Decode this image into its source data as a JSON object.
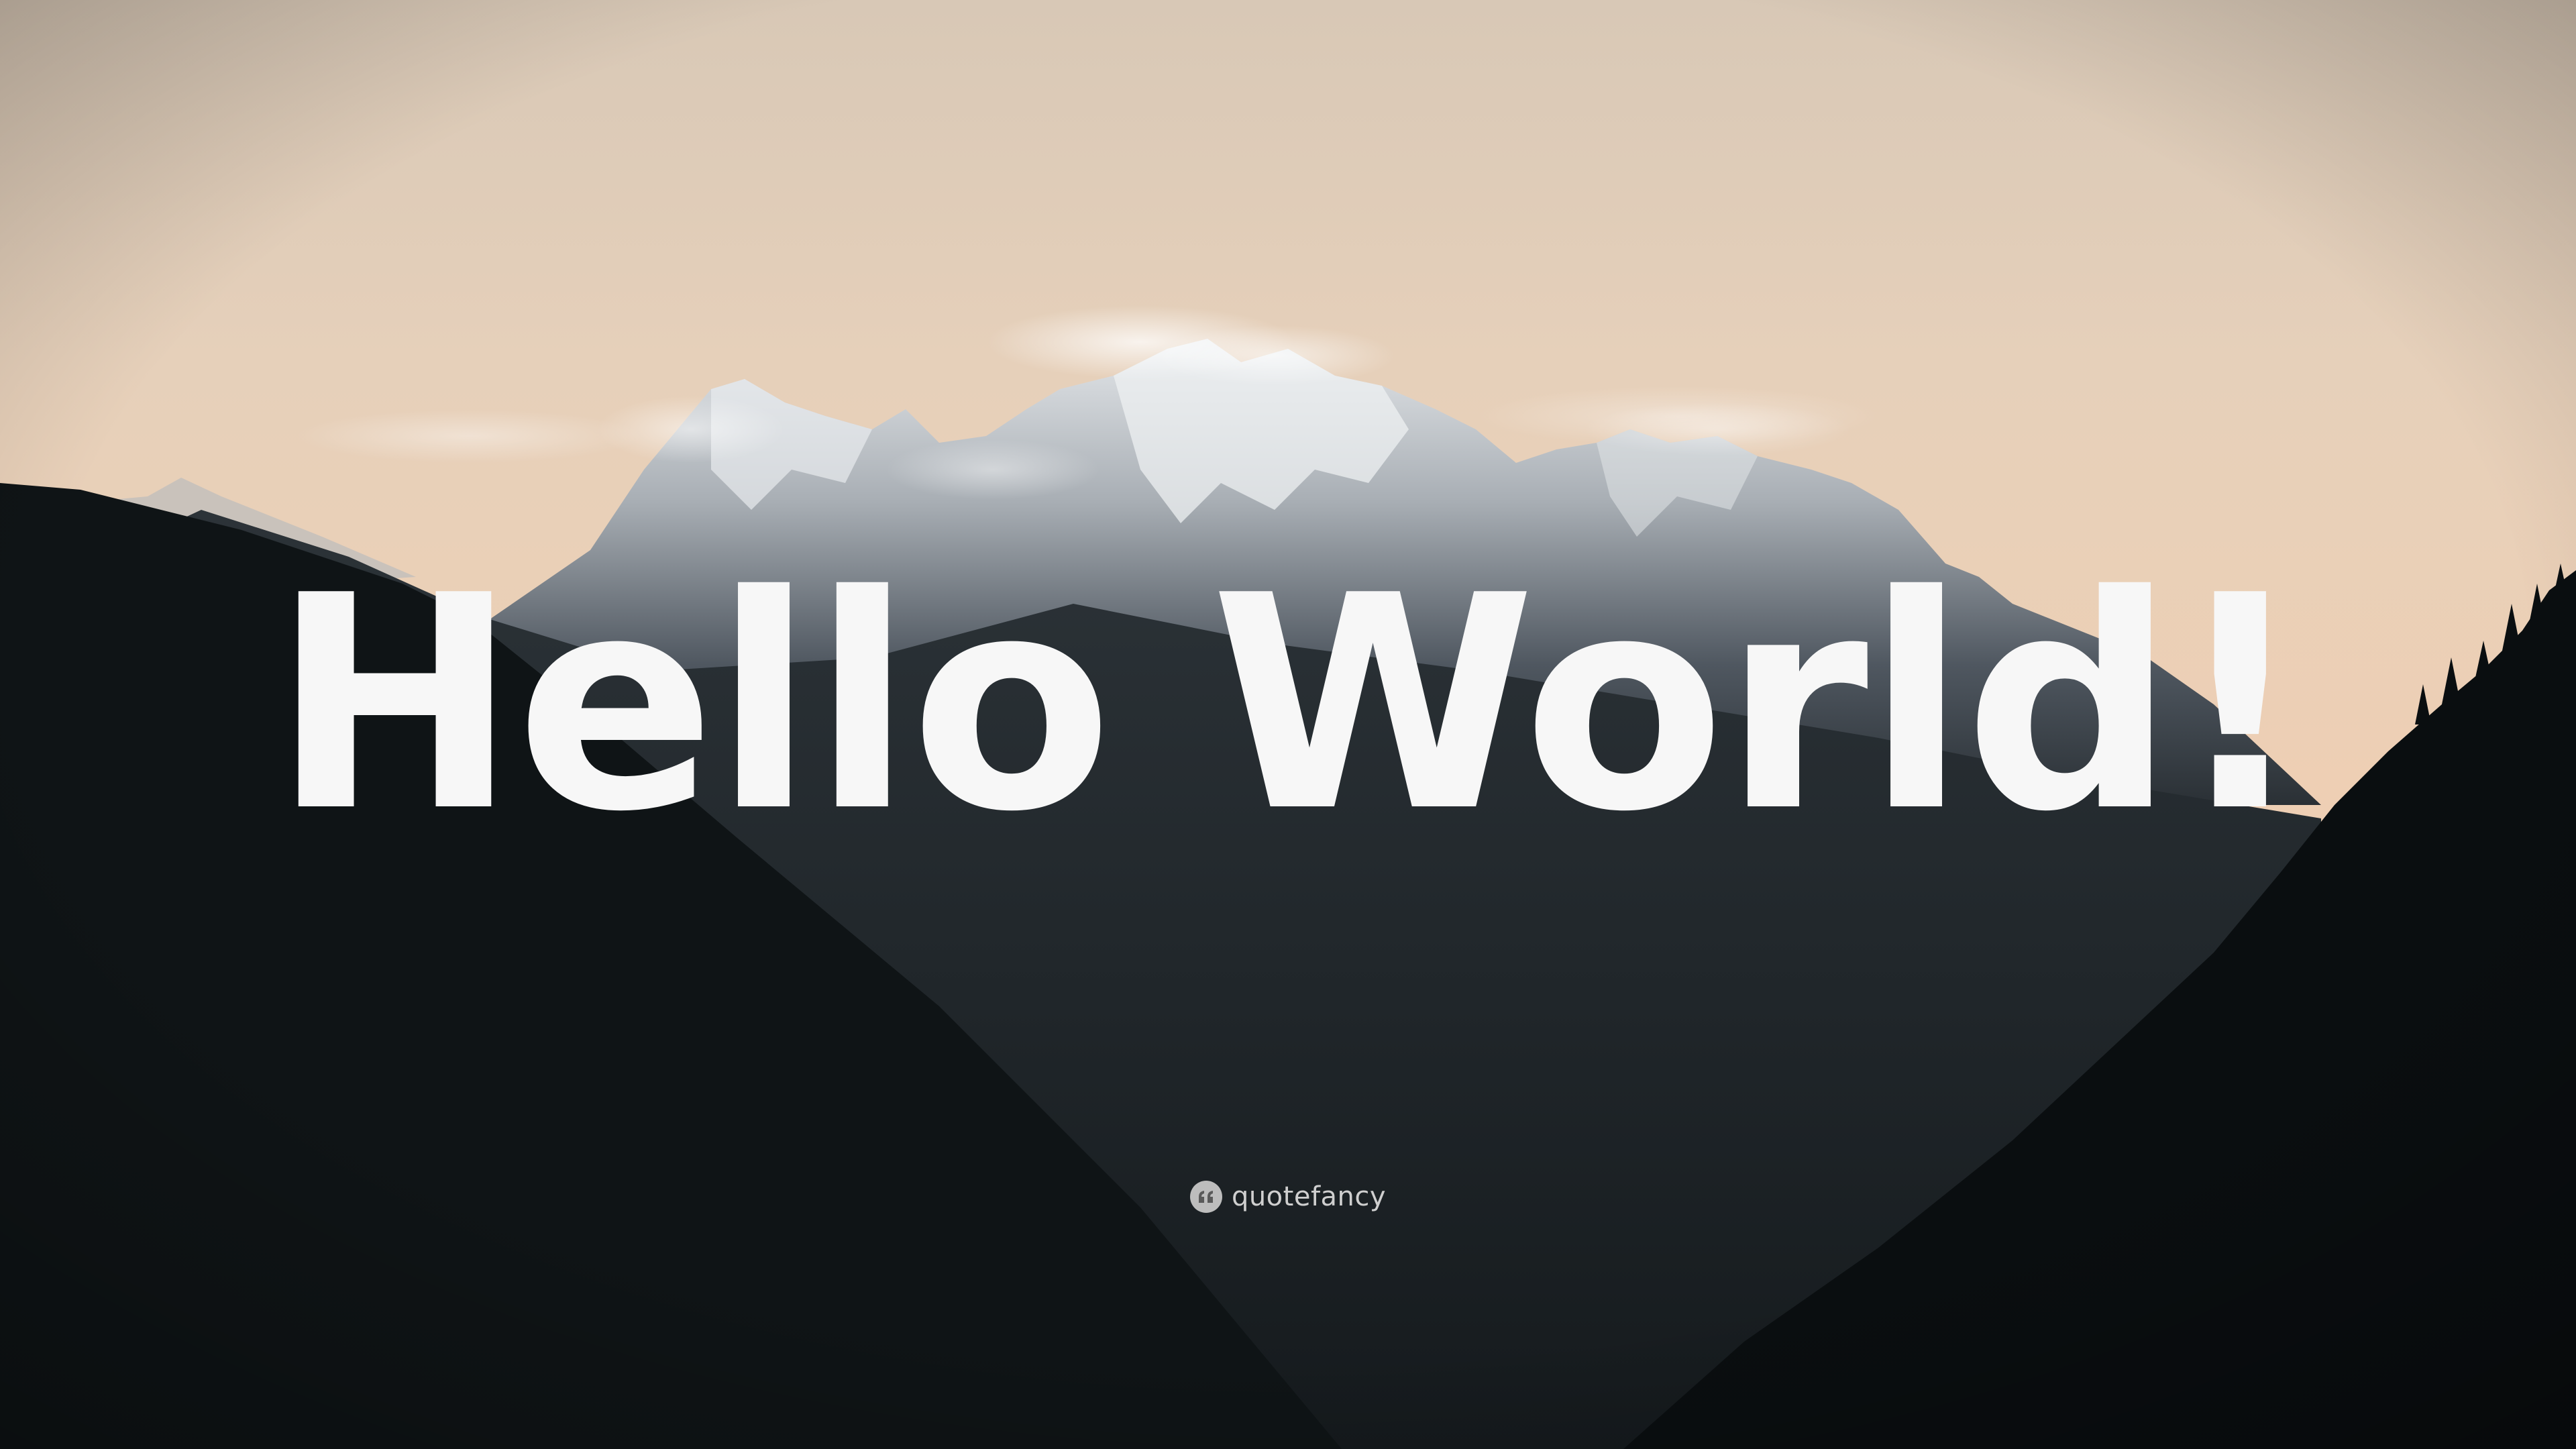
{
  "quote": {
    "text": "Hello World!"
  },
  "brand": {
    "name": "quotefancy",
    "icon": "quote-marks-icon"
  },
  "colors": {
    "sky_top": "#d7c5b2",
    "sky_bottom": "#eccfb5",
    "snow": "#dfe3e6",
    "rock": "#5e6670",
    "mountain_dark": "#1a2024",
    "forest": "#0e1214",
    "text": "#f7f7f7"
  }
}
